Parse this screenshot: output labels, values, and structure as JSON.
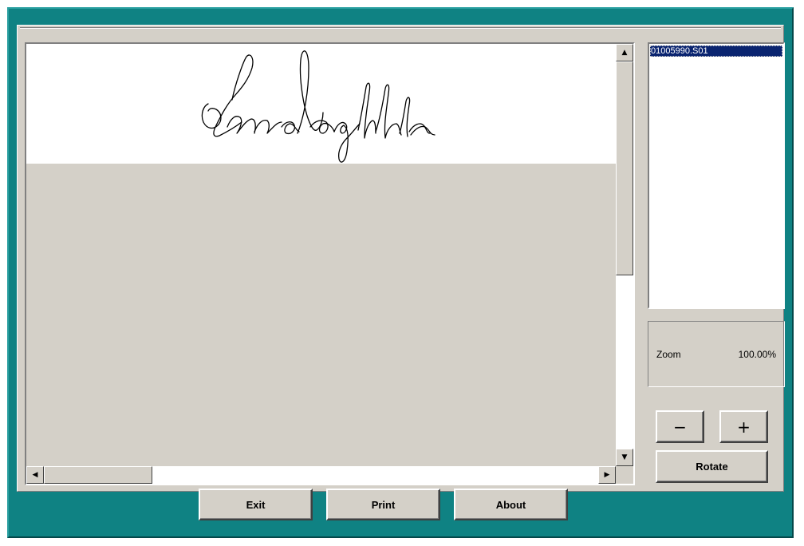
{
  "viewer": {
    "signature_alt": "signature-image"
  },
  "list": {
    "items": [
      "01005990.S01"
    ]
  },
  "zoom": {
    "label": "Zoom",
    "value": "100.00%"
  },
  "controls": {
    "zoom_out_label": "−",
    "zoom_in_label": "+",
    "rotate_label": "Rotate"
  },
  "footer": {
    "exit_label": "Exit",
    "print_label": "Print",
    "about_label": "About"
  },
  "colors": {
    "frame": "#0f8283",
    "panel": "#d4d0c8",
    "selection": "#0a2470"
  },
  "icons": {
    "scroll_up": "up-arrow-icon",
    "scroll_down": "down-arrow-icon",
    "scroll_left": "left-arrow-icon",
    "scroll_right": "right-arrow-icon"
  }
}
